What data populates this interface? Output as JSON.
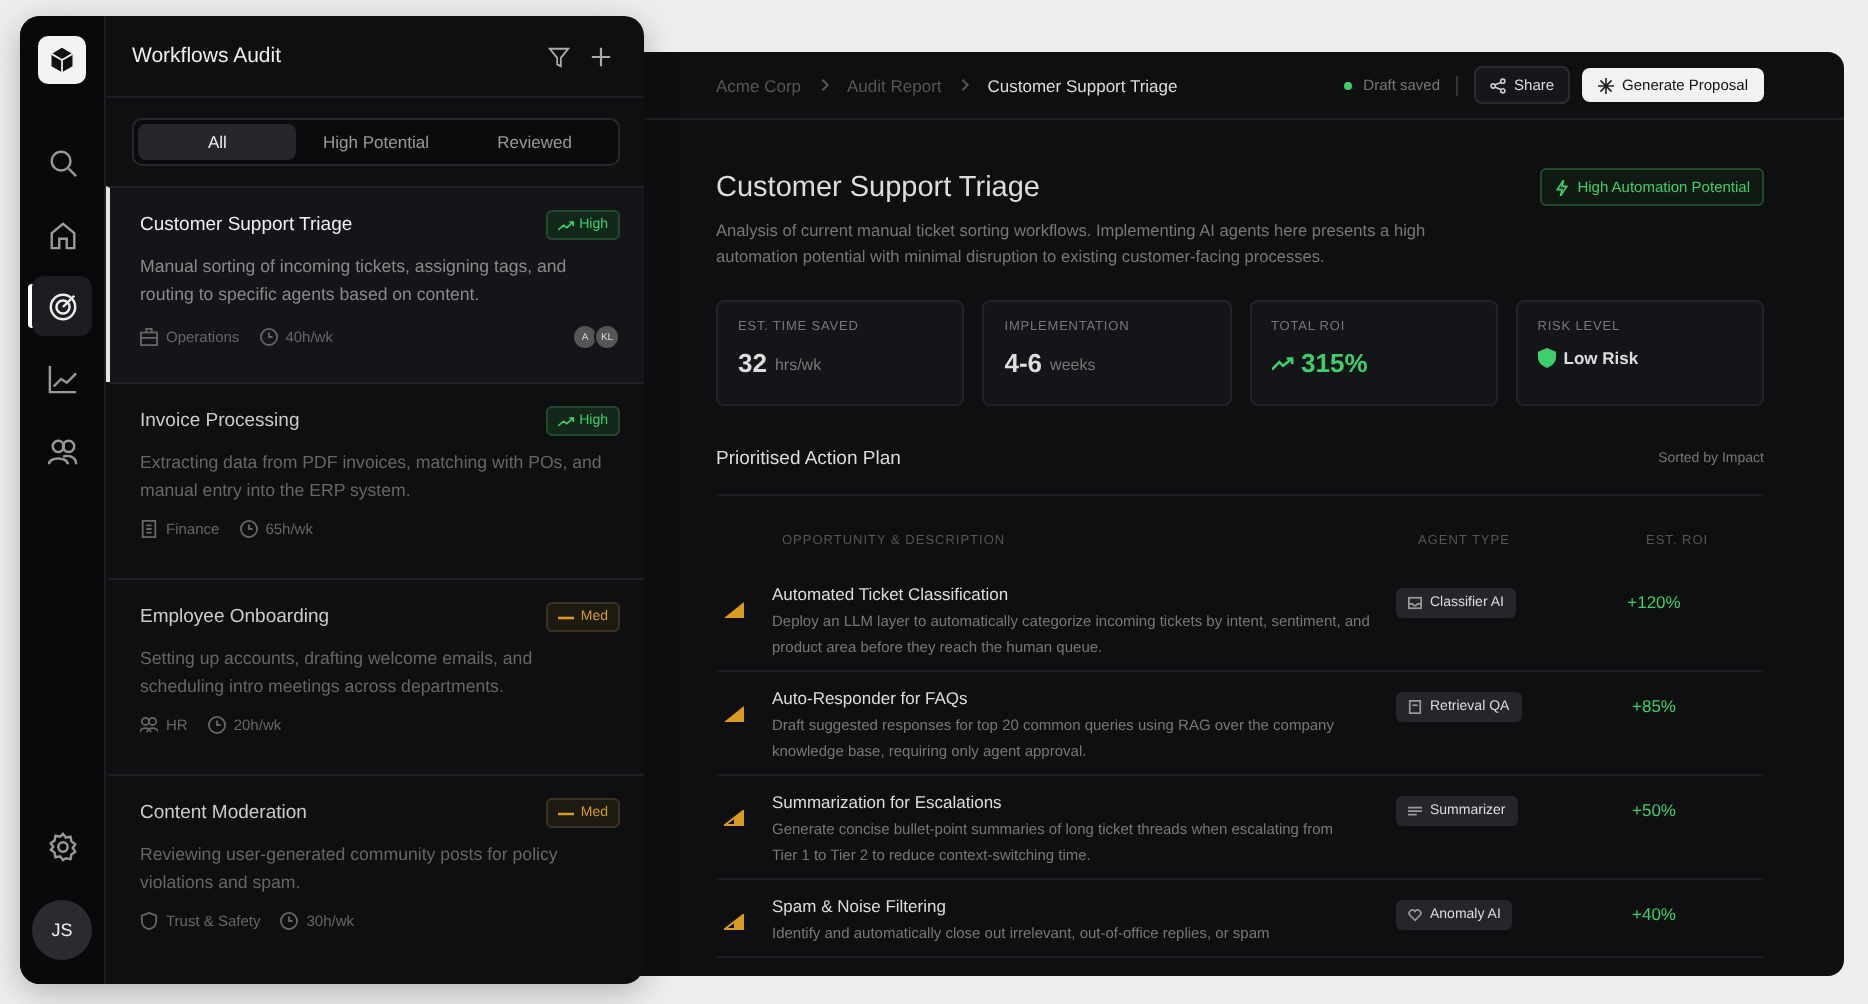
{
  "rail": {
    "items": [
      {
        "kind": "search",
        "selected": false
      },
      {
        "kind": "home",
        "selected": false
      },
      {
        "kind": "target",
        "selected": true
      },
      {
        "kind": "chart",
        "selected": false
      },
      {
        "kind": "users",
        "selected": false
      }
    ],
    "avatar": "JS"
  },
  "list": {
    "title": "Workflows Audit",
    "tabs": [
      {
        "label": "All",
        "selected": true
      },
      {
        "label": "High Potential",
        "selected": false
      },
      {
        "label": "Reviewed",
        "selected": false
      }
    ],
    "items": [
      {
        "title": "Customer Support Triage",
        "selected": true,
        "potential": {
          "kind": "high",
          "label": "High"
        },
        "description": "Manual sorting of incoming tickets, assigning tags, and routing to specific agents based on content.",
        "department": {
          "kind": "briefcase",
          "label": "Operations"
        },
        "hours": "40h/wk",
        "avatars": [
          "A",
          "KL"
        ]
      },
      {
        "title": "Invoice Processing",
        "selected": false,
        "potential": {
          "kind": "high",
          "label": "High"
        },
        "description": "Extracting data from PDF invoices, matching with POs, and manual entry into the ERP system.",
        "department": {
          "kind": "building",
          "label": "Finance"
        },
        "hours": "65h/wk"
      },
      {
        "title": "Employee Onboarding",
        "selected": false,
        "potential": {
          "kind": "med",
          "label": "Med"
        },
        "description": "Setting up accounts, drafting welcome emails, and scheduling intro meetings across departments.",
        "department": {
          "kind": "people",
          "label": "HR"
        },
        "hours": "20h/wk"
      },
      {
        "title": "Content Moderation",
        "selected": false,
        "potential": {
          "kind": "med",
          "label": "Med"
        },
        "description": "Reviewing user-generated community posts for policy violations and spam.",
        "department": {
          "kind": "shield",
          "label": "Trust & Safety"
        },
        "hours": "30h/wk"
      }
    ]
  },
  "header": {
    "breadcrumbs": [
      "Acme Corp",
      "Audit Report",
      "Customer Support Triage"
    ],
    "status": "Draft saved",
    "share": "Share",
    "generate": "Generate Proposal"
  },
  "detail": {
    "title": "Customer Support Triage",
    "badge": "High Automation Potential",
    "description": "Analysis of current manual ticket sorting workflows. Implementing AI agents here presents a high automation potential with minimal disruption to existing customer-facing processes.",
    "metrics": [
      {
        "kind": "plain",
        "label": "EST. TIME SAVED",
        "value": "32",
        "unit": "hrs/wk"
      },
      {
        "kind": "plain",
        "label": "IMPLEMENTATION",
        "value": "4-6",
        "unit": "weeks"
      },
      {
        "kind": "trend",
        "label": "TOTAL ROI",
        "value": "315%"
      },
      {
        "kind": "risk",
        "label": "RISK LEVEL",
        "value": "Low Risk"
      }
    ],
    "plan": {
      "title": "Prioritised Action Plan",
      "sort": "Sorted by Impact",
      "columns": [
        "OPPORTUNITY & DESCRIPTION",
        "AGENT TYPE",
        "EST. ROI"
      ],
      "rows": [
        {
          "kind": "high",
          "title": "Automated Ticket Classification",
          "description": "Deploy an LLM layer to automatically categorize incoming tickets by intent, sentiment, and product area before they reach the human queue.",
          "agent": {
            "kind": "inbox",
            "label": "Classifier AI"
          },
          "roi": "+120%"
        },
        {
          "kind": "high",
          "title": "Auto-Responder for FAQs",
          "description": "Draft suggested responses for top 20 common queries using RAG over the company knowledge base, requiring only agent approval.",
          "agent": {
            "kind": "book",
            "label": "Retrieval QA"
          },
          "roi": "+85%"
        },
        {
          "kind": "medium",
          "title": "Summarization for Escalations",
          "description": "Generate concise bullet-point summaries of long ticket threads when escalating from\nTier 1 to Tier 2 to reduce context-switching time.",
          "agent": {
            "kind": "lines",
            "label": "Summarizer"
          },
          "roi": "+50%"
        },
        {
          "kind": "medium",
          "title": "Spam & Noise Filtering",
          "description": "Identify and automatically close out irrelevant, out-of-office replies, or spam",
          "agent": {
            "kind": "heart",
            "label": "Anomaly AI"
          },
          "roi": "+40%"
        }
      ]
    }
  }
}
